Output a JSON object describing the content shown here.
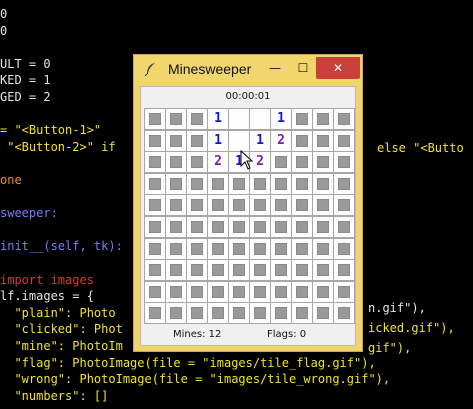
{
  "editor": {
    "lines": [
      {
        "text": "0",
        "color": "#e6e6e6"
      },
      {
        "text": "0",
        "color": "#e6e6e6"
      },
      {
        "text": "",
        "color": "#e6e6e6"
      },
      {
        "text": "ULT = 0",
        "color": "#e6e6e6"
      },
      {
        "text": "KED = 1",
        "color": "#e6e6e6"
      },
      {
        "text": "GED = 2",
        "color": "#e6e6e6"
      },
      {
        "text": "",
        "color": "#e6e6e6"
      },
      {
        "text": "= \"<Button-1>\"",
        "color": "#f0e130"
      },
      {
        "text": " \"<Button-2>\" if",
        "color": "#f0e130"
      },
      {
        "text": "",
        "color": "#e6e6e6"
      },
      {
        "text": "one",
        "color": "#f08a24"
      },
      {
        "text": "",
        "color": "#e6e6e6"
      },
      {
        "text": "sweeper:",
        "color": "#7b7bff"
      },
      {
        "text": "",
        "color": "#e6e6e6"
      },
      {
        "text": "init__(self, tk):",
        "color": "#7b7bff"
      },
      {
        "text": "",
        "color": "#e6e6e6"
      },
      {
        "text": "import images",
        "color": "#d23a3a"
      },
      {
        "text": "lf.images = {",
        "color": "#e6e6e6"
      },
      {
        "text": "  \"plain\": Photo",
        "color": "#f0e130"
      },
      {
        "text": "  \"clicked\": Phot",
        "color": "#f0e130"
      },
      {
        "text": "  \"mine\": PhotoIm",
        "color": "#f0e130"
      },
      {
        "text": "  \"flag\": PhotoImage(file = \"images/tile_flag.gif\"),",
        "color": "#f0e130"
      },
      {
        "text": "  \"wrong\": PhotoImage(file = \"images/tile_wrong.gif\"),",
        "color": "#f0e130"
      },
      {
        "text": "  \"numbers\": []",
        "color": "#f0e130"
      }
    ],
    "right_fragments": [
      {
        "text": "else \"<Butto",
        "color": "#f0e130"
      },
      {
        "text": "n.gif\"),",
        "color": "#e6e6e6"
      },
      {
        "text": "icked.gif\"),",
        "color": "#f0e130"
      },
      {
        "text": "gif\"),",
        "color": "#f0e130"
      }
    ]
  },
  "window": {
    "title": "Minesweeper",
    "minimize_label": "—",
    "maximize_label": "☐",
    "close_label": "✕",
    "timer": "00:00:01",
    "mines_label": "Mines: 12",
    "flags_label": "Flags: 0"
  },
  "board": {
    "rows": 10,
    "cols": 10,
    "number_colors": {
      "1": "#1515d8",
      "2": "#7a1fa8"
    },
    "open_cells": [
      {
        "r": 0,
        "c": 3,
        "v": "1"
      },
      {
        "r": 0,
        "c": 4,
        "v": ""
      },
      {
        "r": 0,
        "c": 5,
        "v": ""
      },
      {
        "r": 0,
        "c": 6,
        "v": "1"
      },
      {
        "r": 1,
        "c": 3,
        "v": "1"
      },
      {
        "r": 1,
        "c": 4,
        "v": ""
      },
      {
        "r": 1,
        "c": 5,
        "v": "1"
      },
      {
        "r": 1,
        "c": 6,
        "v": "2"
      },
      {
        "r": 2,
        "c": 3,
        "v": "2"
      },
      {
        "r": 2,
        "c": 4,
        "v": "1"
      },
      {
        "r": 2,
        "c": 5,
        "v": "2"
      }
    ]
  }
}
